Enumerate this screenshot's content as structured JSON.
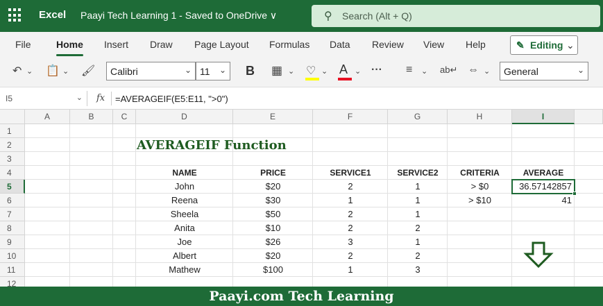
{
  "titlebar": {
    "app_name": "Excel",
    "doc_title": "Paayi Tech Learning 1  -  Saved to OneDrive ∨",
    "search_placeholder": "Search (Alt + Q)"
  },
  "menu": {
    "tabs": [
      "File",
      "Home",
      "Insert",
      "Draw",
      "Page Layout",
      "Formulas",
      "Data",
      "Review",
      "View",
      "Help"
    ],
    "active_tab": "Home",
    "editing_label": "Editing"
  },
  "ribbon": {
    "font_name": "Calibri",
    "font_size": "11",
    "bold_label": "B",
    "font_color_label": "A",
    "number_format": "General",
    "more_label": "···"
  },
  "formula_bar": {
    "name_box": "I5",
    "fx_label": "fx",
    "formula": "=AVERAGEIF(E5:E11, \">0\")"
  },
  "sheet": {
    "columns": [
      "A",
      "B",
      "C",
      "D",
      "E",
      "F",
      "G",
      "H",
      "I"
    ],
    "rows": [
      "1",
      "2",
      "3",
      "4",
      "5",
      "6",
      "7",
      "8",
      "9",
      "10",
      "11",
      "12"
    ],
    "selected_column": "I",
    "selected_row": "5",
    "title": "AVERAGEIF Function",
    "headers": [
      "NAME",
      "PRICE",
      "SERVICE1",
      "SERVICE2",
      "CRITERIA",
      "AVERAGE"
    ],
    "data": [
      [
        "John",
        "$20",
        "2",
        "1"
      ],
      [
        "Reena",
        "$30",
        "1",
        "1"
      ],
      [
        "Sheela",
        "$50",
        "2",
        "1"
      ],
      [
        "Anita",
        "$10",
        "2",
        "2"
      ],
      [
        "Joe",
        "$26",
        "3",
        "1"
      ],
      [
        "Albert",
        "$20",
        "2",
        "2"
      ],
      [
        "Mathew",
        "$100",
        "1",
        "3"
      ]
    ],
    "criteria": [
      "> $0",
      "> $10"
    ],
    "averages": [
      "36.57142857",
      "41"
    ]
  },
  "footer": {
    "text": "Paayi.com Tech Learning"
  },
  "colors": {
    "brand_green": "#1e6b37",
    "title_green": "#1e5b20"
  }
}
